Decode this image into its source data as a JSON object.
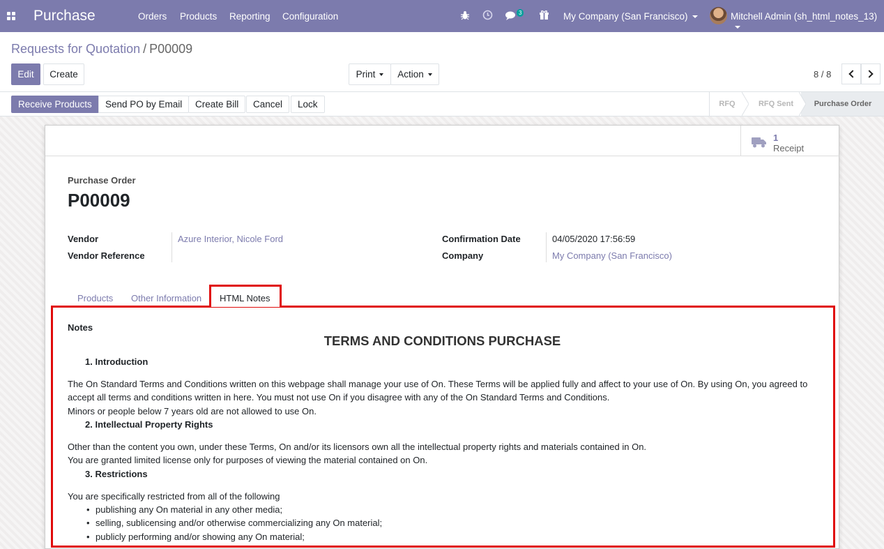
{
  "navbar": {
    "app_name": "Purchase",
    "menu": [
      "Orders",
      "Products",
      "Reporting",
      "Configuration"
    ],
    "messages_count": "3",
    "company": "My Company (San Francisco)",
    "user": "Mitchell Admin (sh_html_notes_13)"
  },
  "breadcrumb": {
    "parent": "Requests for Quotation",
    "separator": "/",
    "current": "P00009"
  },
  "control": {
    "edit": "Edit",
    "create": "Create",
    "print": "Print",
    "action": "Action",
    "pager": "8 / 8"
  },
  "statusbar": {
    "buttons": [
      "Receive Products",
      "Send PO by Email",
      "Create Bill",
      "Cancel",
      "Lock"
    ],
    "stages": [
      "RFQ",
      "RFQ Sent",
      "Purchase Order"
    ],
    "active_stage": "Purchase Order"
  },
  "smart_button": {
    "value": "1",
    "label": "Receipt"
  },
  "form": {
    "doc_label": "Purchase Order",
    "doc_name": "P00009",
    "vendor_label": "Vendor",
    "vendor": "Azure Interior, Nicole Ford",
    "vendor_ref_label": "Vendor Reference",
    "vendor_ref": "",
    "confirmation_label": "Confirmation Date",
    "confirmation_date": "04/05/2020 17:56:59",
    "company_label": "Company",
    "company": "My Company (San Francisco)"
  },
  "tabs": [
    "Products",
    "Other Information",
    "HTML Notes"
  ],
  "active_tab": "HTML Notes",
  "notes": {
    "label": "Notes",
    "title": "TERMS AND CONDITIONS PURCHASE",
    "sec1": "1. Introduction",
    "p1a": "The On Standard Terms and Conditions written on this webpage shall manage your use of On. These Terms will be applied fully and affect to your use of On. By using On, you agreed to",
    "p1b": "accept all terms and conditions written in here. You must not use On if you disagree with any of the On Standard Terms and Conditions.",
    "p1c": "Minors or people below 7 years old are not allowed to use On.",
    "sec2": "2. Intellectual Property Rights",
    "p2a": "Other than the content you own, under these Terms, On and/or its licensors own all the intellectual property rights and materials contained in On.",
    "p2b": "You are granted limited license only for purposes of viewing the material contained on On.",
    "sec3": "3. Restrictions",
    "p3": "You are specifically restricted from all of the following",
    "bullets": [
      "publishing any On material in any other media;",
      "selling, sublicensing and/or otherwise commercializing any On material;",
      "publicly performing and/or showing any On material;"
    ]
  },
  "colors": {
    "brand": "#7c7bad",
    "highlight": "#e00b0b",
    "badge": "#00a09d"
  }
}
